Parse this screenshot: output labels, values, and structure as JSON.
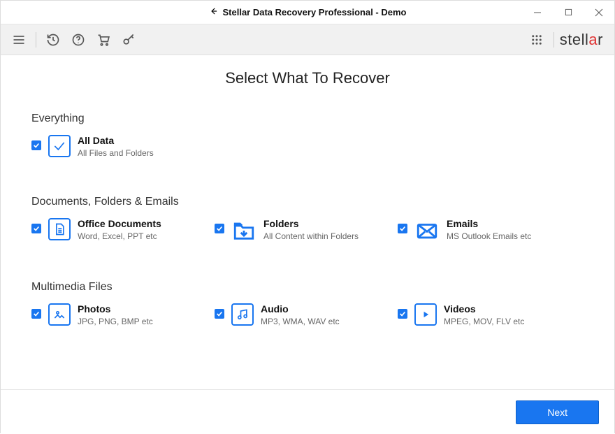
{
  "window": {
    "title": "Stellar Data Recovery Professional - Demo"
  },
  "brand": {
    "name": "stellar"
  },
  "page": {
    "heading": "Select What To Recover"
  },
  "sections": {
    "everything": {
      "label": "Everything",
      "alldata": {
        "title": "All Data",
        "sub": "All Files and Folders"
      }
    },
    "docs": {
      "label": "Documents, Folders & Emails",
      "office": {
        "title": "Office Documents",
        "sub": "Word, Excel, PPT etc"
      },
      "folders": {
        "title": "Folders",
        "sub": "All Content within Folders"
      },
      "emails": {
        "title": "Emails",
        "sub": "MS Outlook Emails etc"
      }
    },
    "media": {
      "label": "Multimedia Files",
      "photos": {
        "title": "Photos",
        "sub": "JPG, PNG, BMP etc"
      },
      "audio": {
        "title": "Audio",
        "sub": "MP3, WMA, WAV etc"
      },
      "videos": {
        "title": "Videos",
        "sub": "MPEG, MOV, FLV etc"
      }
    }
  },
  "footer": {
    "next": "Next"
  }
}
